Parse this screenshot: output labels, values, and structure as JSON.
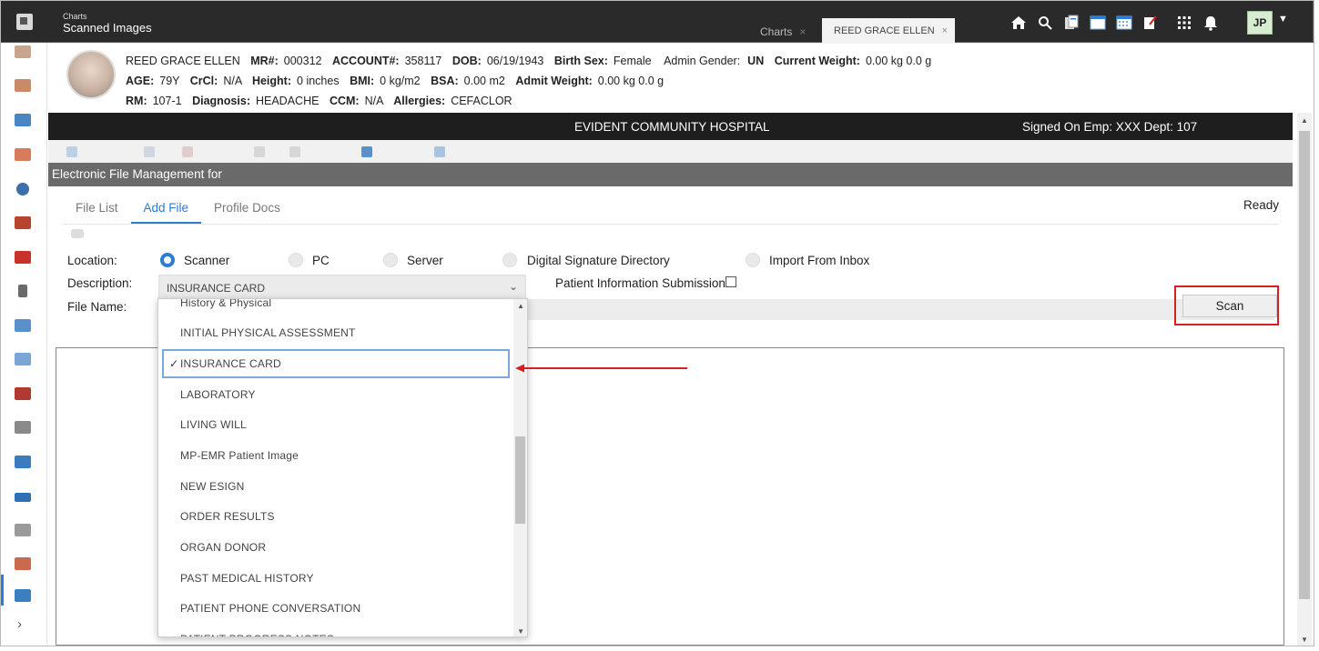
{
  "topbar": {
    "breadcrumb_parent": "Charts",
    "breadcrumb_current": "Scanned Images",
    "tabs": [
      {
        "label": "Charts"
      },
      {
        "label": "REED GRACE ELLEN"
      }
    ],
    "close_glyph": "×",
    "icons": [
      "home-icon",
      "search-icon",
      "documents-icon",
      "window-icon",
      "calendar-icon",
      "notes-icon",
      "apps-grid-icon",
      "bell-icon"
    ],
    "user_initials": "JP"
  },
  "patient": {
    "name": "REED GRACE ELLEN",
    "mr_label": "MR#:",
    "mr": "000312",
    "account_label": "ACCOUNT#:",
    "account": "358117",
    "dob_label": "DOB:",
    "dob": "06/19/1943",
    "birth_sex_label": "Birth Sex:",
    "birth_sex": "Female",
    "admin_gender_label": "Admin Gender:",
    "admin_gender": "UN",
    "current_weight_label": "Current Weight:",
    "current_weight": "0.00 kg 0.0 g",
    "age_label": "AGE:",
    "age": "79Y",
    "crcl_label": "CrCl:",
    "crcl": "N/A",
    "height_label": "Height:",
    "height": "0 inches",
    "bmi_label": "BMI:",
    "bmi": "0 kg/m2",
    "bsa_label": "BSA:",
    "bsa": "0.00 m2",
    "admit_weight_label": "Admit Weight:",
    "admit_weight": "0.00 kg 0.0 g",
    "rm_label": "RM:",
    "rm": "107-1",
    "diagnosis_label": "Diagnosis:",
    "diagnosis": "HEADACHE",
    "ccm_label": "CCM:",
    "ccm": "N/A",
    "allergies_label": "Allergies:",
    "allergies": "CEFACLOR"
  },
  "hospital": {
    "title": "EVIDENT COMMUNITY HOSPITAL",
    "signed_on": "Signed On Emp: XXX Dept: 107"
  },
  "section_title": "Electronic File Management for",
  "tabs": [
    {
      "label": "File List"
    },
    {
      "label": "Add File"
    },
    {
      "label": "Profile Docs"
    }
  ],
  "status": "Ready",
  "form": {
    "location_label": "Location:",
    "locations": [
      "Scanner",
      "PC",
      "Server",
      "Digital Signature Directory",
      "Import From Inbox"
    ],
    "selected_location": "Scanner",
    "description_label": "Description:",
    "description_value": "INSURANCE CARD",
    "patient_info_label": "Patient Information Submission",
    "filename_label": "File Name:",
    "scan_button": "Scan"
  },
  "dropdown": {
    "items": [
      "History & Physical",
      "INITIAL PHYSICAL ASSESSMENT",
      "INSURANCE CARD",
      "LABORATORY",
      "LIVING WILL",
      "MP-EMR Patient Image",
      "NEW ESIGN",
      "ORDER RESULTS",
      "ORGAN DONOR",
      "PAST MEDICAL HISTORY",
      "PATIENT PHONE CONVERSATION",
      "PATIENT PROGRESS NOTES"
    ],
    "selected": "INSURANCE CARD",
    "check_glyph": "✓"
  },
  "colors": {
    "accent": "#2b7cd3",
    "highlight": "#d42020",
    "topbar": "#2a2a2a",
    "section_bar": "#6a6a6a"
  }
}
